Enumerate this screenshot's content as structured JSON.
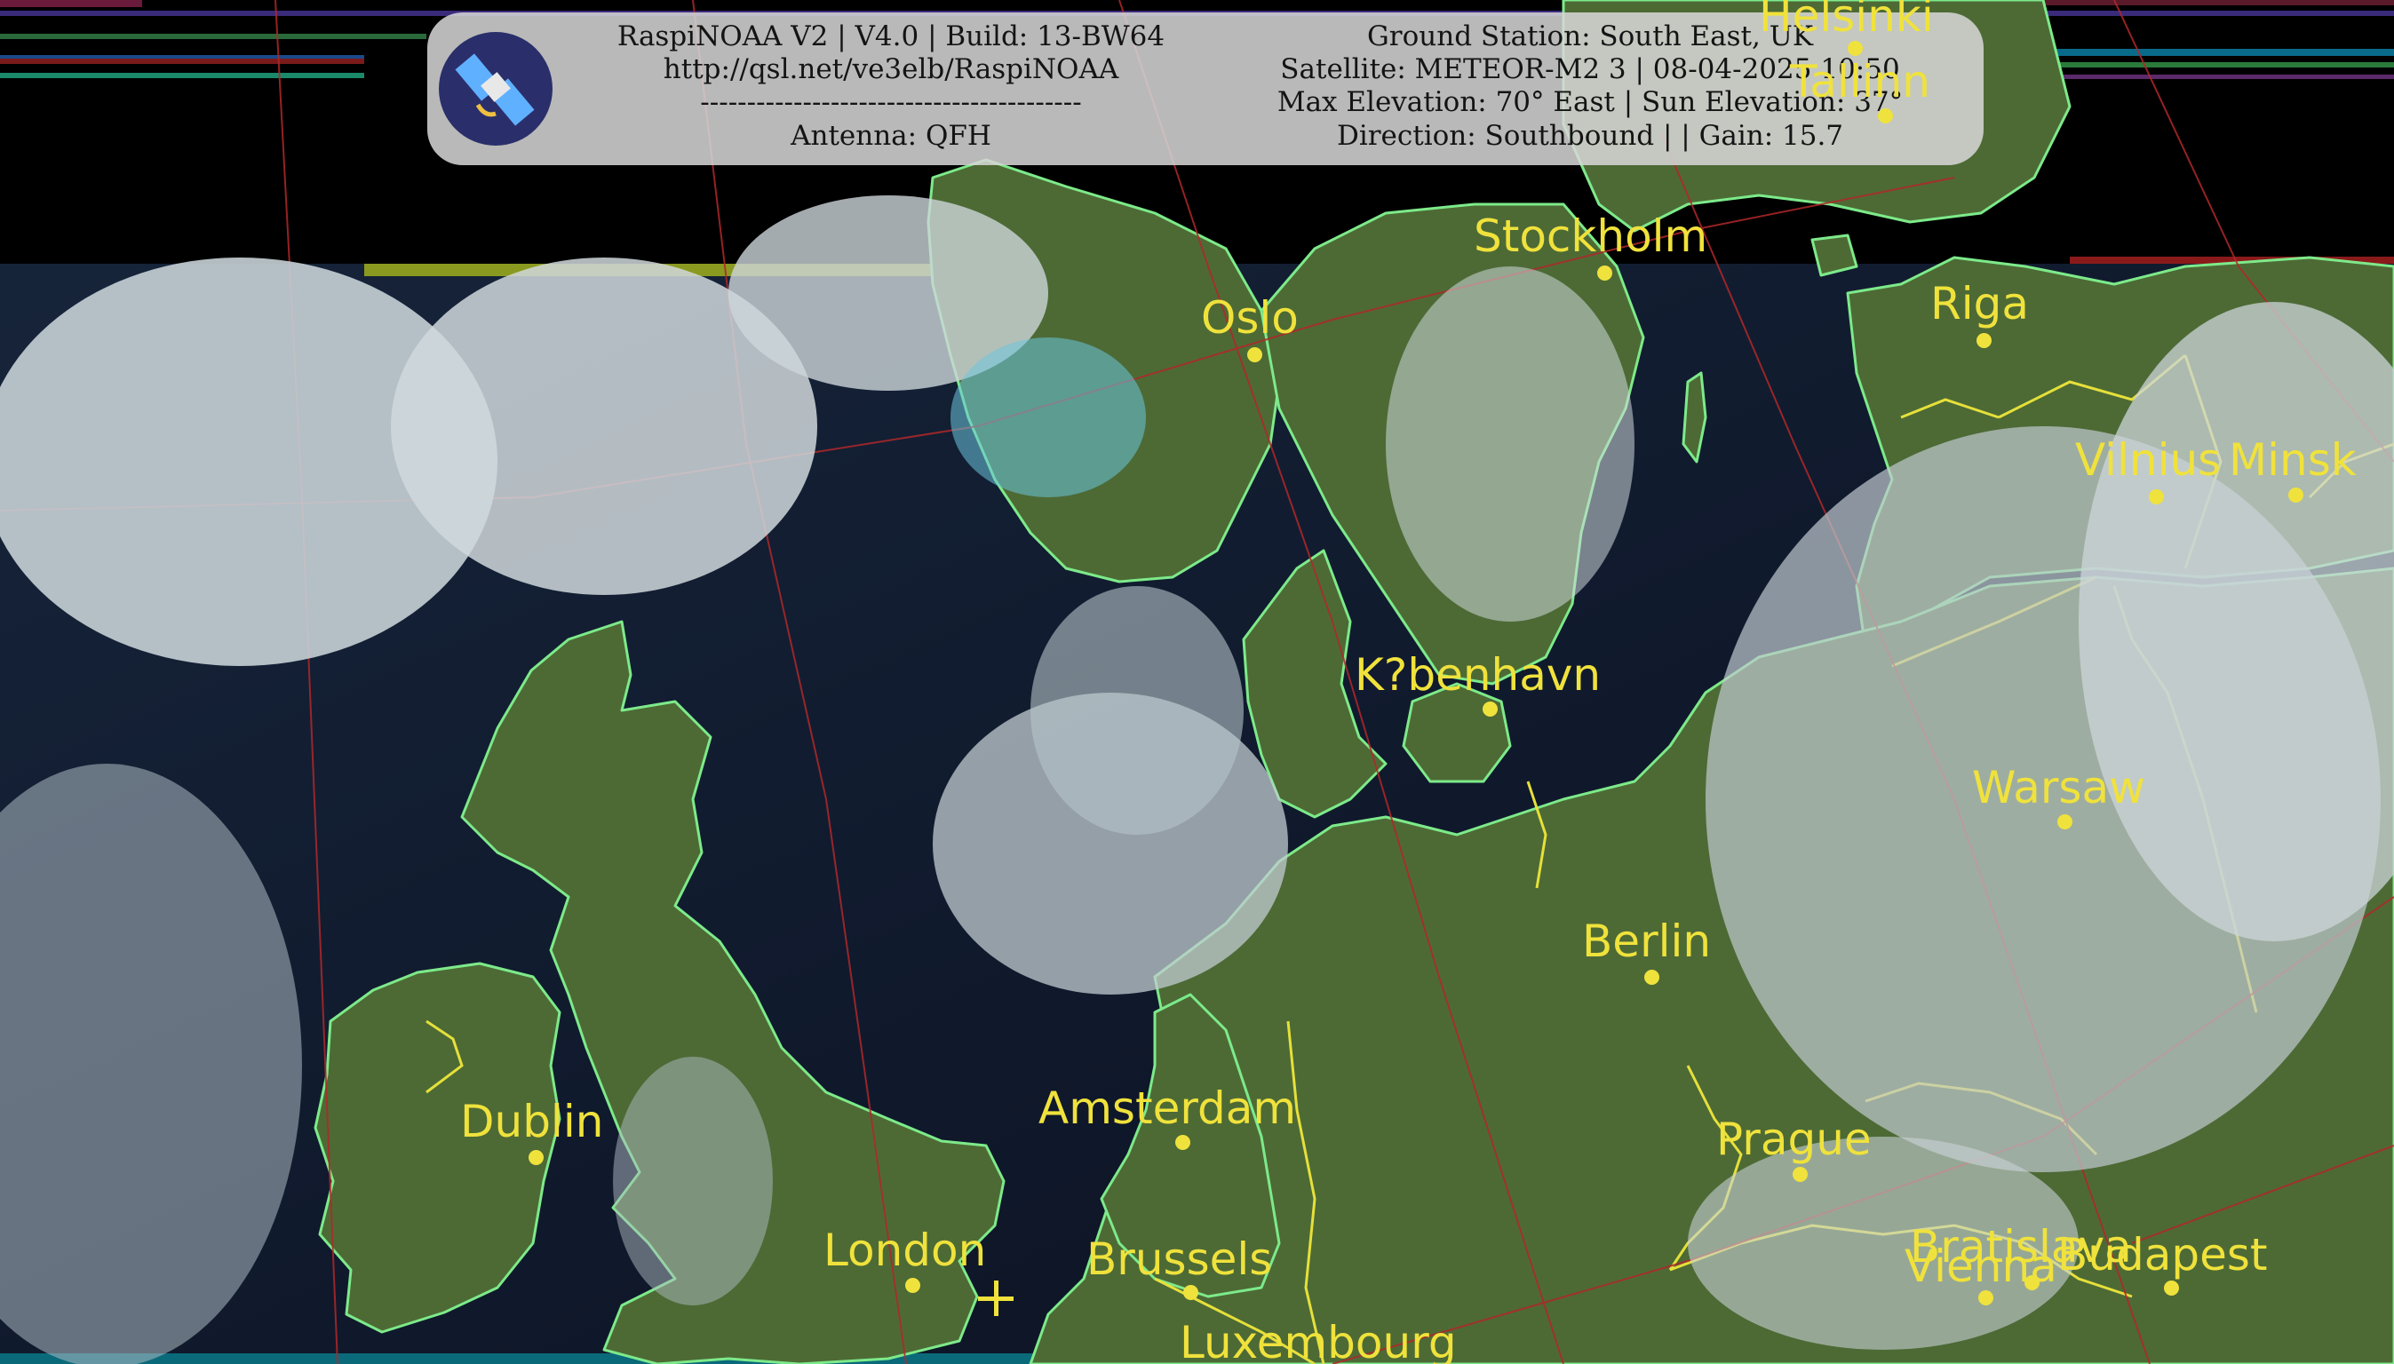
{
  "header": {
    "left_lines": [
      "RaspiNOAA V2 | V4.0 | Build: 13-BW64",
      "http://qsl.net/ve3elb/RaspiNOAA",
      "-----------------------------------------",
      "Antenna: QFH"
    ],
    "right_lines": [
      "Ground Station: South East, UK",
      "Satellite: METEOR-M2 3 | 08-04-2025 10:50",
      "Max Elevation: 70° East | Sun Elevation: 37°",
      "Direction: Southbound | | Gain: 15.7"
    ],
    "logo_icon": "satellite-icon"
  },
  "cities": [
    {
      "name": "Helsinki"
    },
    {
      "name": "Tallinn"
    },
    {
      "name": "Stockholm"
    },
    {
      "name": "Oslo"
    },
    {
      "name": "Riga"
    },
    {
      "name": "Vilnius"
    },
    {
      "name": "Minsk"
    },
    {
      "name": "K?benhavn"
    },
    {
      "name": "Warsaw"
    },
    {
      "name": "Berlin"
    },
    {
      "name": "Dublin"
    },
    {
      "name": "Amsterdam"
    },
    {
      "name": "Prague"
    },
    {
      "name": "London"
    },
    {
      "name": "Brussels"
    },
    {
      "name": "Bratislava"
    },
    {
      "name": "Vienna"
    },
    {
      "name": "Budapest"
    },
    {
      "name": "Luxembourg"
    }
  ],
  "colors": {
    "label": "#f0e23c",
    "coastline": "#7dea8a",
    "border": "#e6e03a",
    "graticule": "#b0282a",
    "sea": "#0e1424",
    "land": "#4d6a35",
    "cloud": "#c6d0d6"
  }
}
